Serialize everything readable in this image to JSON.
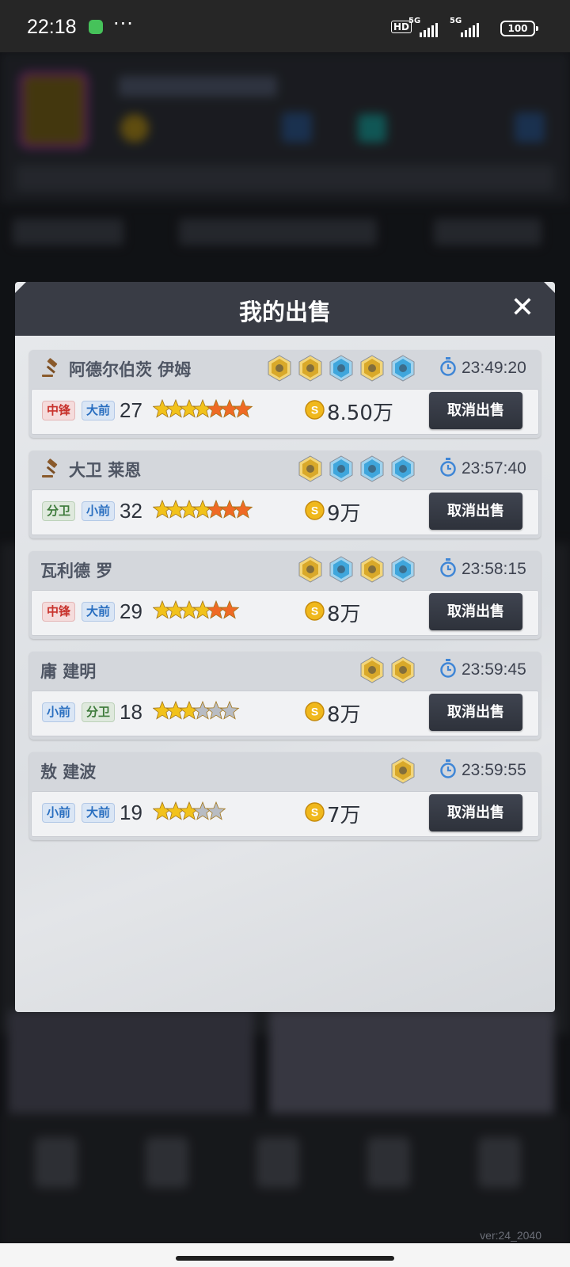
{
  "status_bar": {
    "time": "22:18",
    "dots": "···",
    "hd": "HD",
    "sim1": "5G",
    "sim2": "5G",
    "battery": "100"
  },
  "dialog": {
    "title": "我的出售",
    "close_label": "✕",
    "cancel_label": "取消出售",
    "entries": [
      {
        "auction": true,
        "name": "阿德尔伯茨 伊姆",
        "badges": [
          "gold",
          "gold",
          "blue",
          "gold",
          "blue"
        ],
        "time": "23:49:20",
        "positions": [
          {
            "text": "中锋",
            "tone": "red"
          },
          {
            "text": "大前",
            "tone": "blue"
          }
        ],
        "age": "27",
        "stars": {
          "gold": 4,
          "orange": 3,
          "silver": 0
        },
        "price": "8.50万"
      },
      {
        "auction": true,
        "name": "大卫 莱恩",
        "badges": [
          "gold",
          "blue",
          "blue",
          "blue"
        ],
        "time": "23:57:40",
        "positions": [
          {
            "text": "分卫",
            "tone": "green"
          },
          {
            "text": "小前",
            "tone": "blue"
          }
        ],
        "age": "32",
        "stars": {
          "gold": 4,
          "orange": 3,
          "silver": 0
        },
        "price": "9万"
      },
      {
        "auction": false,
        "name": "瓦利德 罗",
        "badges": [
          "gold",
          "blue",
          "gold",
          "blue"
        ],
        "time": "23:58:15",
        "positions": [
          {
            "text": "中锋",
            "tone": "red"
          },
          {
            "text": "大前",
            "tone": "blue"
          }
        ],
        "age": "29",
        "stars": {
          "gold": 4,
          "orange": 2,
          "silver": 0
        },
        "price": "8万"
      },
      {
        "auction": false,
        "name": "庸 建明",
        "badges": [
          "gold",
          "gold"
        ],
        "time": "23:59:45",
        "positions": [
          {
            "text": "小前",
            "tone": "blue"
          },
          {
            "text": "分卫",
            "tone": "green"
          }
        ],
        "age": "18",
        "stars": {
          "gold": 3,
          "orange": 0,
          "silver": 3
        },
        "price": "8万"
      },
      {
        "auction": false,
        "name": "敖 建波",
        "badges": [
          "gold"
        ],
        "time": "23:59:55",
        "positions": [
          {
            "text": "小前",
            "tone": "blue"
          },
          {
            "text": "大前",
            "tone": "blue"
          }
        ],
        "age": "19",
        "stars": {
          "gold": 3,
          "orange": 0,
          "silver": 2
        },
        "price": "7万"
      }
    ]
  },
  "footer": {
    "version": "ver:24_2040"
  },
  "colors": {
    "dialog_header": "#393c45",
    "button": "#2e323b",
    "star_gold": "#f2c21b",
    "star_orange": "#ef6a25",
    "badge_gold": "#d9a92a",
    "badge_blue": "#3fa6dc"
  }
}
